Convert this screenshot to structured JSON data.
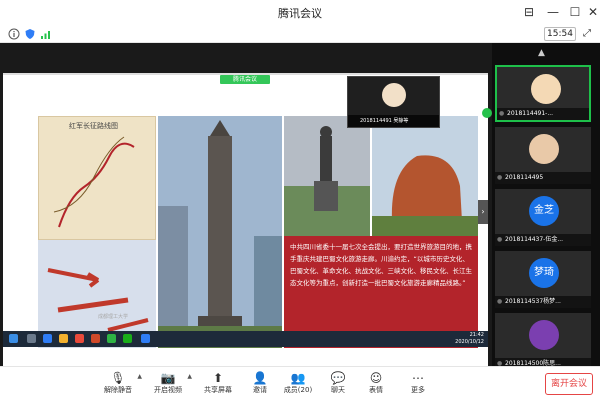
{
  "window": {
    "title": "腾讯会议"
  },
  "infobar": {
    "clock": "15:54"
  },
  "sharing": {
    "tag": "腾讯会议"
  },
  "slide": {
    "map_title": "红军长征路线图",
    "text": "中共四川省委十一届七次全会提出，要打造世界旅游目的地，携手重庆共建巴蜀文化旅游走廊。川渝约定，“以城市历史文化、巴蜀文化、革命文化、抗战文化、三峡文化、移民文化、长江生态文化等为重点，创新打造一批巴蜀文化旅游走廊精品线路。”",
    "footer": "成都理工大学"
  },
  "presenter": {
    "name": "2018114491 吴静等"
  },
  "taskbar": {
    "clock_time": "21:42",
    "clock_date": "2020/10/12"
  },
  "participants": [
    {
      "label": "2018114491-...",
      "avatar_text": "",
      "color": "#f4d9b5"
    },
    {
      "label": "2018114495",
      "avatar_text": "",
      "color": "#e9c9a8"
    },
    {
      "label": "2018114437-伍金...",
      "avatar_text": "金芝",
      "color": "#1a73e8"
    },
    {
      "label": "2018114537杨梦...",
      "avatar_text": "梦琦",
      "color": "#1a73e8"
    },
    {
      "label": "2018114500陈思...",
      "avatar_text": "",
      "color": "#7b3fb0"
    }
  ],
  "toolbar": {
    "mute": "解除静音",
    "video": "开启视频",
    "share": "共享屏幕",
    "invite": "邀请",
    "members": "成员(20)",
    "chat": "聊天",
    "emoji": "表情",
    "more": "更多",
    "leave": "离开会议"
  }
}
